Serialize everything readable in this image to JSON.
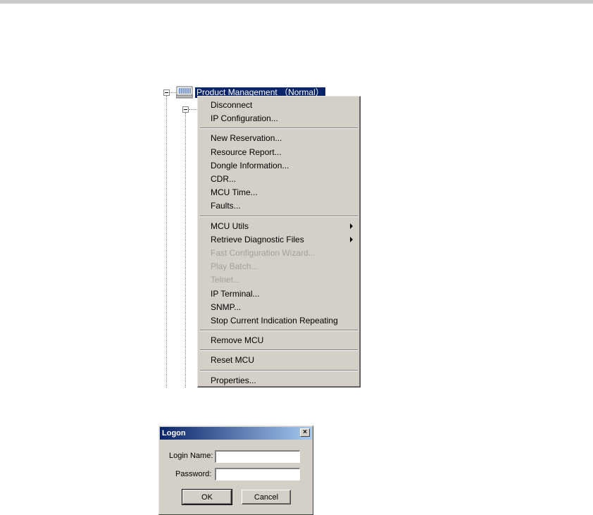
{
  "tree": {
    "root_label": "Product Management （Normal）",
    "root_icon": "mcu-computer-icon"
  },
  "context_menu": {
    "groups": [
      [
        {
          "label": "Disconnect",
          "enabled": true
        },
        {
          "label": "IP Configuration...",
          "enabled": true
        }
      ],
      [
        {
          "label": "New Reservation...",
          "enabled": true
        },
        {
          "label": "Resource Report...",
          "enabled": true
        },
        {
          "label": "Dongle Information...",
          "enabled": true
        },
        {
          "label": "CDR...",
          "enabled": true
        },
        {
          "label": "MCU Time...",
          "enabled": true
        },
        {
          "label": "Faults...",
          "enabled": true
        }
      ],
      [
        {
          "label": "MCU Utils",
          "enabled": true,
          "submenu": true
        },
        {
          "label": "Retrieve Diagnostic Files",
          "enabled": true,
          "submenu": true
        },
        {
          "label": "Fast Configuration Wizard...",
          "enabled": false
        },
        {
          "label": "Play Batch...",
          "enabled": false
        },
        {
          "label": "Telnet...",
          "enabled": false
        },
        {
          "label": "IP Terminal...",
          "enabled": true
        },
        {
          "label": "SNMP...",
          "enabled": true
        },
        {
          "label": "Stop Current Indication Repeating",
          "enabled": true
        }
      ],
      [
        {
          "label": "Remove MCU",
          "enabled": true
        }
      ],
      [
        {
          "label": "Reset MCU",
          "enabled": true
        }
      ],
      [
        {
          "label": "Properties...",
          "enabled": true
        }
      ]
    ]
  },
  "logon_dialog": {
    "title": "Logon",
    "close_glyph": "×",
    "login_name_label": "Login Name:",
    "login_name_value": "",
    "password_label": "Password:",
    "password_value": "",
    "ok_label": "OK",
    "cancel_label": "Cancel"
  },
  "colors": {
    "selection": "#0a246a",
    "face": "#d4d0c8",
    "disabled_text": "#a3a19b"
  }
}
